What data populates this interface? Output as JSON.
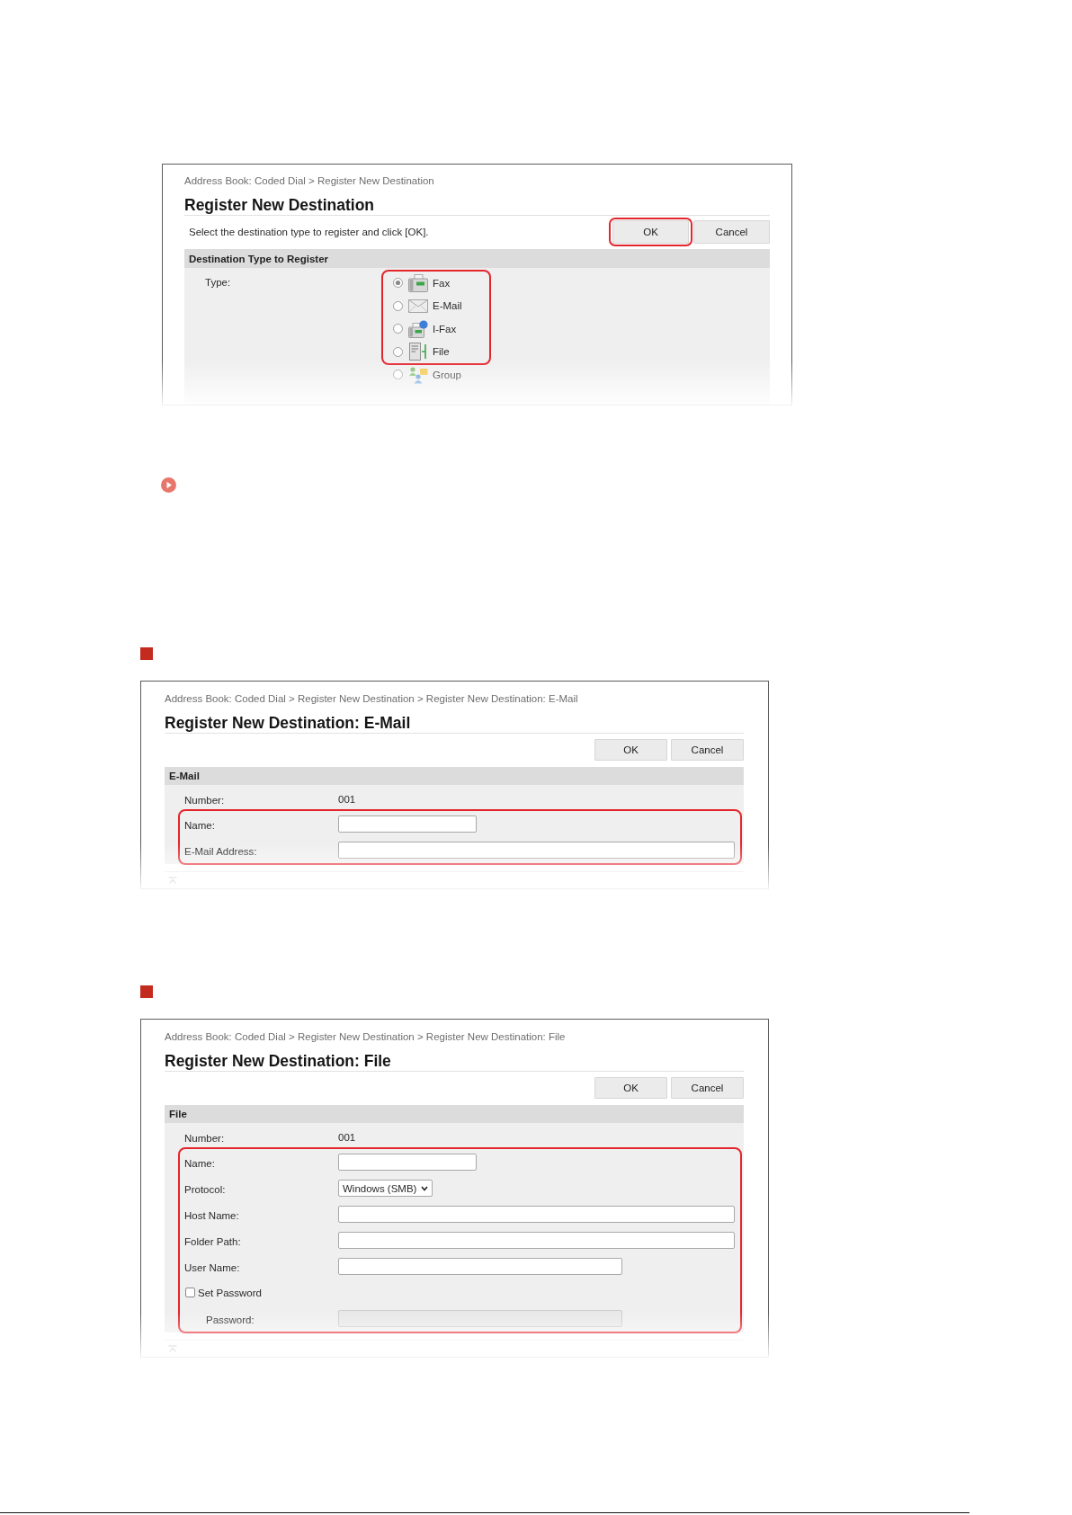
{
  "blocks": [
    {
      "kind": "type_dialog",
      "breadcrumb": "Address Book: Coded Dial > Register New Destination",
      "title": "Register New Destination",
      "instruction": "Select the destination type to register and click [OK].",
      "buttons": [
        {
          "label": "OK",
          "highlighted": true
        },
        {
          "label": "Cancel",
          "highlighted": false
        }
      ],
      "section": "Destination Type to Register",
      "type_label": "Type:",
      "option_groups": [
        {
          "highlighted": true,
          "options": [
            {
              "kind": "fax",
              "label": "Fax",
              "selected": true
            },
            {
              "kind": "email",
              "label": "E-Mail",
              "selected": false
            },
            {
              "kind": "ifax",
              "label": "I-Fax",
              "selected": false
            },
            {
              "kind": "file",
              "label": "File",
              "selected": false
            }
          ]
        },
        {
          "highlighted": false,
          "options": [
            {
              "kind": "group",
              "label": "Group",
              "selected": false
            }
          ]
        }
      ]
    },
    {
      "kind": "link_marker"
    },
    {
      "kind": "section_marker"
    },
    {
      "kind": "form_dialog",
      "breadcrumb": "Address Book: Coded Dial > Register New Destination > Register New Destination: E-Mail",
      "title": "Register New Destination: E-Mail",
      "buttons": [
        {
          "label": "OK",
          "highlighted": false
        },
        {
          "label": "Cancel",
          "highlighted": false
        }
      ],
      "section": "E-Mail",
      "groups": [
        {
          "highlighted": false,
          "rows": [
            {
              "kind": "text",
              "label": "Number:",
              "value": "001"
            }
          ]
        },
        {
          "highlighted": true,
          "rows": [
            {
              "kind": "short_field",
              "label": "Name:",
              "disabled": false
            },
            {
              "kind": "long_field",
              "label": "E-Mail Address:",
              "disabled": false
            }
          ]
        }
      ]
    },
    {
      "kind": "section_marker"
    },
    {
      "kind": "form_dialog",
      "breadcrumb": "Address Book: Coded Dial > Register New Destination > Register New Destination: File",
      "title": "Register New Destination: File",
      "buttons": [
        {
          "label": "OK",
          "highlighted": false
        },
        {
          "label": "Cancel",
          "highlighted": false
        }
      ],
      "section": "File",
      "groups": [
        {
          "highlighted": false,
          "rows": [
            {
              "kind": "text",
              "label": "Number:",
              "value": "001"
            }
          ]
        },
        {
          "highlighted": true,
          "rows": [
            {
              "kind": "short_field",
              "label": "Name:",
              "disabled": false
            },
            {
              "kind": "select",
              "label": "Protocol:",
              "value": "Windows (SMB)",
              "disabled": false
            },
            {
              "kind": "long_field",
              "label": "Host Name:",
              "disabled": false
            },
            {
              "kind": "long_field",
              "label": "Folder Path:",
              "disabled": false
            },
            {
              "kind": "medium_field",
              "label": "User Name:",
              "disabled": false
            },
            {
              "kind": "checkbox",
              "label": "Set Password",
              "checked": false,
              "children": [
                {
                  "kind": "medium_field",
                  "label": "Password:",
                  "disabled": true
                }
              ]
            }
          ]
        }
      ]
    }
  ]
}
